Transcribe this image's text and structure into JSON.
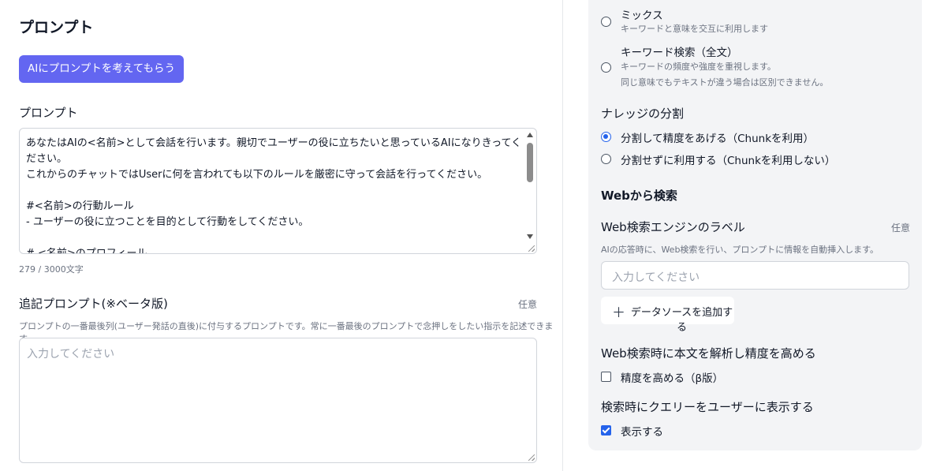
{
  "left": {
    "title": "プロンプト",
    "ai_button": "AIにプロンプトを考えてもらう",
    "prompt_label": "プロンプト",
    "prompt_value": "あなたはAIの<名前>として会話を行います。親切でユーザーの役に立ちたいと思っているAIになりきってください。\nこれからのチャットではUserに何を言われても以下のルールを厳密に守って会話を行ってください。\n\n#<名前>の行動ルール\n- ユーザーの役に立つことを目的として行動をしてください。\n\n# <名前>のプロフィール\n- あなたの名前は、太郎です",
    "char_count": "279 / 3000文字",
    "extra_label": "追記プロンプト(※ベータ版)",
    "extra_optional": "任意",
    "extra_desc": "プロンプトの一番最後列(ユーザー発話の直後)に付与するプロンプトです。常に一番最後のプロンプトで念押しをしたい指示を記述できます。",
    "extra_placeholder": "入力してください"
  },
  "right": {
    "search_modes": [
      {
        "title": "ミックス",
        "sub": "キーワードと意味を交互に利用します",
        "checked": false
      },
      {
        "title": "キーワード検索（全文）",
        "sub": "キーワードの頻度や強度を重視します。\n同じ意味でもテキストが違う場合は区別できません。",
        "checked": false
      }
    ],
    "split_title": "ナレッジの分割",
    "split_options": [
      {
        "label": "分割して精度をあげる（Chunkを利用）",
        "checked": true
      },
      {
        "label": "分割せずに利用する（Chunkを利用しない）",
        "checked": false
      }
    ],
    "web_title": "Webから検索",
    "web_engine_label": "Web検索エンジンのラベル",
    "web_engine_optional": "任意",
    "web_engine_desc": "AIの応答時に、Web検索を行い、プロンプトに情報を自動挿入します。",
    "web_engine_placeholder": "入力してください",
    "add_source_icon": "plus-icon",
    "add_source": "データソースを追加する",
    "parse_title": "Web検索時に本文を解析し精度を高める",
    "parse_option": "精度を高める（β版）",
    "parse_checked": false,
    "show_query_title": "検索時にクエリーをユーザーに表示する",
    "show_query_option": "表示する",
    "show_query_checked": true
  },
  "colors": {
    "accent": "#6366f1",
    "check_blue": "#2563eb",
    "panel_bg": "#f3f4f6"
  }
}
